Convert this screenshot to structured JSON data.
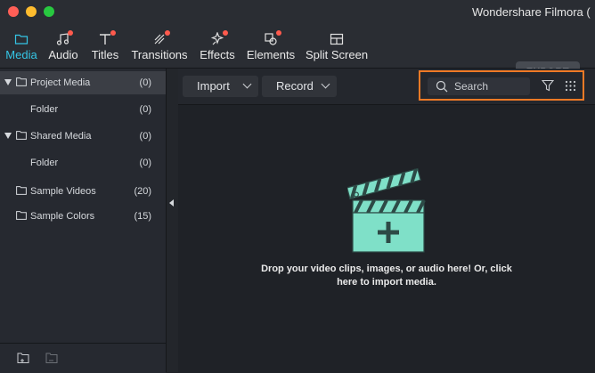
{
  "window": {
    "title": "Wondershare Filmora ("
  },
  "toolbar": {
    "tabs": [
      {
        "label": "Media",
        "icon": "folder-icon",
        "active": true,
        "badge": false
      },
      {
        "label": "Audio",
        "icon": "music-note-icon",
        "active": false,
        "badge": true
      },
      {
        "label": "Titles",
        "icon": "text-icon",
        "active": false,
        "badge": true
      },
      {
        "label": "Transitions",
        "icon": "transition-icon",
        "active": false,
        "badge": true
      },
      {
        "label": "Effects",
        "icon": "magic-icon",
        "active": false,
        "badge": true
      },
      {
        "label": "Elements",
        "icon": "elements-icon",
        "active": false,
        "badge": true
      },
      {
        "label": "Split Screen",
        "icon": "split-screen-icon",
        "active": false,
        "badge": false
      }
    ],
    "export_label": "EXPORT"
  },
  "sidebar": {
    "items": [
      {
        "label": "Project Media",
        "count": "(0)",
        "expandable": true,
        "selected": true
      },
      {
        "label": "Folder",
        "count": "(0)",
        "expandable": false,
        "selected": false
      },
      {
        "label": "Shared Media",
        "count": "(0)",
        "expandable": true,
        "selected": false
      },
      {
        "label": "Folder",
        "count": "(0)",
        "expandable": false,
        "selected": false
      },
      {
        "label": "Sample Videos",
        "count": "(20)",
        "expandable": false,
        "selected": false
      },
      {
        "label": "Sample Colors",
        "count": "(15)",
        "expandable": false,
        "selected": false
      }
    ]
  },
  "main": {
    "import_label": "Import",
    "record_label": "Record",
    "search_placeholder": "Search",
    "empty_message": "Drop your video clips, images, or audio here! Or, click here to import media."
  },
  "colors": {
    "accent": "#35c6e6",
    "badge": "#ff5a4d",
    "search_highlight": "#f07a26",
    "clapper": "#7fe0c8"
  }
}
